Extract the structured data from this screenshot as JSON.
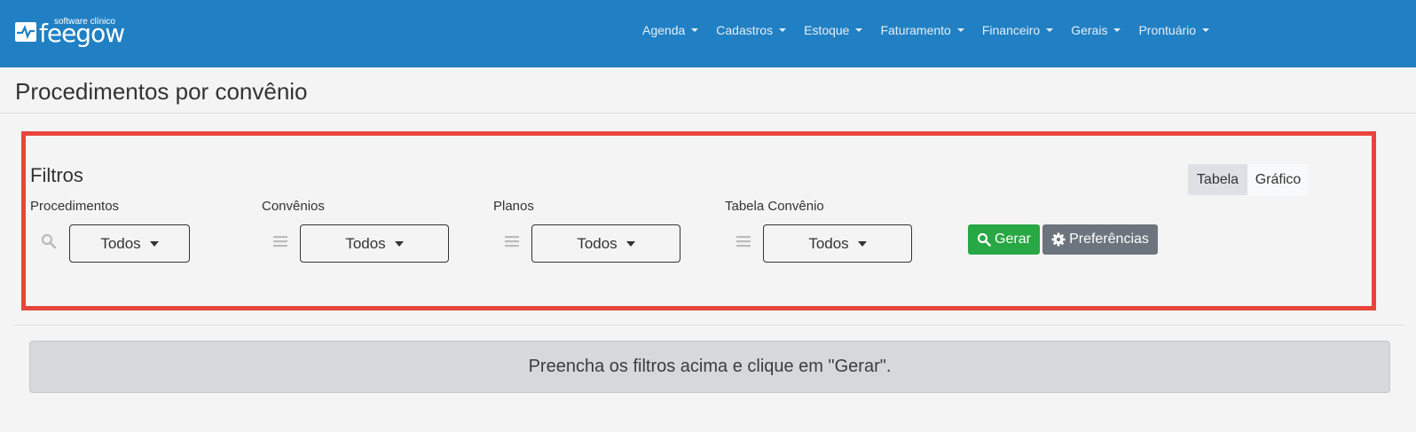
{
  "brand": {
    "small_text": "software clínico",
    "name": "feegow"
  },
  "nav": {
    "items": [
      {
        "label": "Agenda"
      },
      {
        "label": "Cadastros"
      },
      {
        "label": "Estoque"
      },
      {
        "label": "Faturamento"
      },
      {
        "label": "Financeiro"
      },
      {
        "label": "Gerais"
      },
      {
        "label": "Prontuário"
      }
    ]
  },
  "page": {
    "title": "Procedimentos por convênio"
  },
  "filters": {
    "heading": "Filtros",
    "procedimentos": {
      "label": "Procedimentos",
      "value": "Todos",
      "icon": "search-icon"
    },
    "convenios": {
      "label": "Convênios",
      "value": "Todos",
      "icon": "list-icon"
    },
    "planos": {
      "label": "Planos",
      "value": "Todos",
      "icon": "list-icon"
    },
    "tabela_convenio": {
      "label": "Tabela Convênio",
      "value": "Todos",
      "icon": "list-icon"
    },
    "gerar_label": "Gerar",
    "preferencias_label": "Preferências"
  },
  "view_toggle": {
    "tabela": "Tabela",
    "grafico": "Gráfico",
    "active": "Tabela"
  },
  "alert": {
    "message": "Preencha os filtros acima e clique em \"Gerar\"."
  },
  "colors": {
    "navbar": "#2180c3",
    "highlight_border": "#e8453c",
    "success": "#28a745",
    "secondary": "#6c757d"
  }
}
